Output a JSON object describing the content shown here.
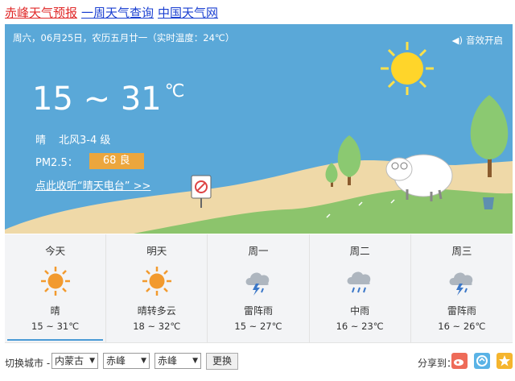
{
  "links": {
    "local": "赤峰天气预报",
    "week": "一周天气查询",
    "cma": "中国天气网"
  },
  "header": {
    "date_line": "周六，06月25日，农历五月廿一（实时温度：24℃）",
    "sound_label": "音效开启",
    "temp_range": "15 ~ 31",
    "temp_unit": "℃",
    "weather": "晴",
    "wind": "北风3-4 级",
    "pm_label": "PM2.5：",
    "pm_value": "68 良",
    "radio_link": "点此收听“晴天电台” >>"
  },
  "forecast": [
    {
      "day": "今天",
      "icon": "sun-icon",
      "desc": "晴",
      "range": "15 ~ 31℃"
    },
    {
      "day": "明天",
      "icon": "sun-icon",
      "desc": "晴转多云",
      "range": "18 ~ 32℃"
    },
    {
      "day": "周一",
      "icon": "thunderstorm-icon",
      "desc": "雷阵雨",
      "range": "15 ~ 27℃"
    },
    {
      "day": "周二",
      "icon": "rain-icon",
      "desc": "中雨",
      "range": "16 ~ 23℃"
    },
    {
      "day": "周三",
      "icon": "thunderstorm-icon",
      "desc": "雷阵雨",
      "range": "16 ~ 26℃"
    }
  ],
  "footer": {
    "switch_label": "切换城市 -",
    "province": "内蒙古",
    "city": "赤峰",
    "district": "赤峰",
    "submit": "更换",
    "share_label": "分享到："
  },
  "colors": {
    "sky": "#5aa8d8",
    "sand": "#efd9a8",
    "grass": "#8cc46c",
    "pm_badge": "#eca63d",
    "sun": "#ffd52a"
  }
}
